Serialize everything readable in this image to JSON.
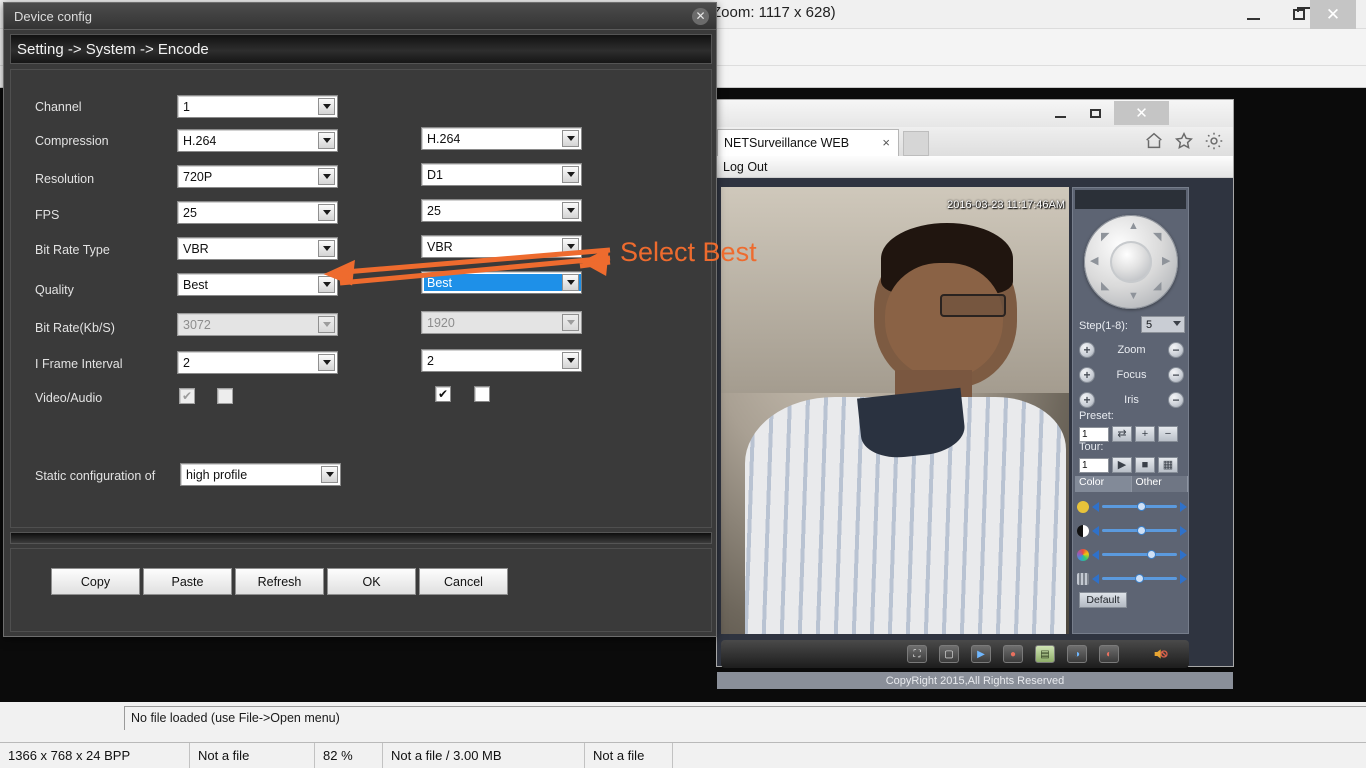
{
  "viewer": {
    "title": "Zoom: 1117 x 628)",
    "status_message": "No file loaded (use File->Open menu)",
    "window_controls": {
      "minimize": "minimize-icon",
      "restore": "restore-icon",
      "close": "✕"
    },
    "statusbar": [
      "1366 x 768 x 24 BPP",
      "Not a file",
      "82 %",
      "Not a file / 3.00 MB",
      "Not a file"
    ]
  },
  "browser": {
    "tab_title": "NETSurveillance WEB",
    "tab_close": "×",
    "menu_item": "Log Out",
    "toolbar_icons": [
      "home-icon",
      "favorites-star-icon",
      "settings-gear-icon"
    ],
    "window_controls": {
      "minimize": "minimize-icon",
      "maximize": "maximize-icon",
      "close": "✕"
    },
    "copyright": "CopyRight 2015,All Rights Reserved",
    "video": {
      "timestamp": "2016-03-23 11:17:46AM"
    },
    "video_toolbar": {
      "icons": [
        "fullscreen-icon",
        "single-window-icon",
        "start-record-icon",
        "stop-record-icon",
        "snapshot-icon",
        "start-talk-icon",
        "stop-talk-icon"
      ],
      "speaker": "speaker-muted-icon"
    },
    "ptz": {
      "step_label": "Step(1-8):",
      "step_value": "5",
      "zoom_label": "Zoom",
      "focus_label": "Focus",
      "iris_label": "Iris",
      "plus": "+",
      "minus": "−",
      "preset_label": "Preset:",
      "preset_value": "1",
      "preset_buttons": [
        "goto-preset-icon",
        "add-preset-icon",
        "remove-preset-icon"
      ],
      "tour_label": "Tour:",
      "tour_value": "1",
      "tour_buttons": [
        "tour-play-icon",
        "tour-stop-icon",
        "tour-grid-icon"
      ],
      "tabs": [
        "Color",
        "Other"
      ],
      "selected_tab": "Color",
      "sliders": [
        {
          "name": "brightness-slider",
          "icon_color": "#e8c33a",
          "value": 50
        },
        {
          "name": "contrast-slider",
          "icon_color": "#ffffff",
          "value": 50
        },
        {
          "name": "saturation-slider",
          "icon_color": "#9b59b6",
          "value": 62
        },
        {
          "name": "hue-slider",
          "icon_color": "#c3c8d1",
          "value": 46
        }
      ],
      "default_button": "Default"
    }
  },
  "dialog": {
    "title": "Device config",
    "close": "✕",
    "breadcrumb": "Setting -> System -> Encode",
    "fields": [
      {
        "label": "Channel",
        "main": "1",
        "sub": null,
        "type": "combo"
      },
      {
        "label": "Compression",
        "main": "H.264",
        "sub": "H.264",
        "type": "combo"
      },
      {
        "label": "Resolution",
        "main": "720P",
        "sub": "D1",
        "type": "combo"
      },
      {
        "label": "FPS",
        "main": "25",
        "sub": "25",
        "type": "combo"
      },
      {
        "label": "Bit Rate Type",
        "main": "VBR",
        "sub": "VBR",
        "type": "combo"
      },
      {
        "label": "Quality",
        "main": "Best",
        "sub": "Best",
        "type": "combo"
      },
      {
        "label": "Bit Rate(Kb/S)",
        "main": "3072",
        "sub": "1920",
        "type": "combo-disabled"
      },
      {
        "label": "I Frame Interval",
        "main": "2",
        "sub": "2",
        "type": "combo"
      },
      {
        "label": "Video/Audio",
        "main": null,
        "sub": null,
        "type": "checkbox"
      }
    ],
    "static_config": {
      "label": "Static configuration of",
      "value": "high profile"
    },
    "buttons": [
      "Copy",
      "Paste",
      "Refresh",
      "OK",
      "Cancel"
    ]
  },
  "annotation": {
    "text": "Select Best",
    "color": "#ee6b2e"
  }
}
